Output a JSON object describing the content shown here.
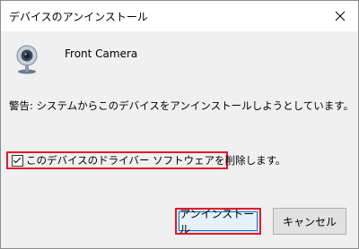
{
  "window": {
    "title": "デバイスのアンインストール",
    "close_icon": "close-icon"
  },
  "device": {
    "icon": "webcam-icon",
    "name": "Front Camera"
  },
  "warning_text": "警告: システムからこのデバイスをアンインストールしようとしています。",
  "checkbox": {
    "label": "このデバイスのドライバー ソフトウェアを削除します。",
    "checked": true
  },
  "buttons": {
    "uninstall_label": "アンインストール",
    "cancel_label": "キャンセル"
  },
  "colors": {
    "highlight": "#e5192b",
    "accent": "#0078d7"
  }
}
